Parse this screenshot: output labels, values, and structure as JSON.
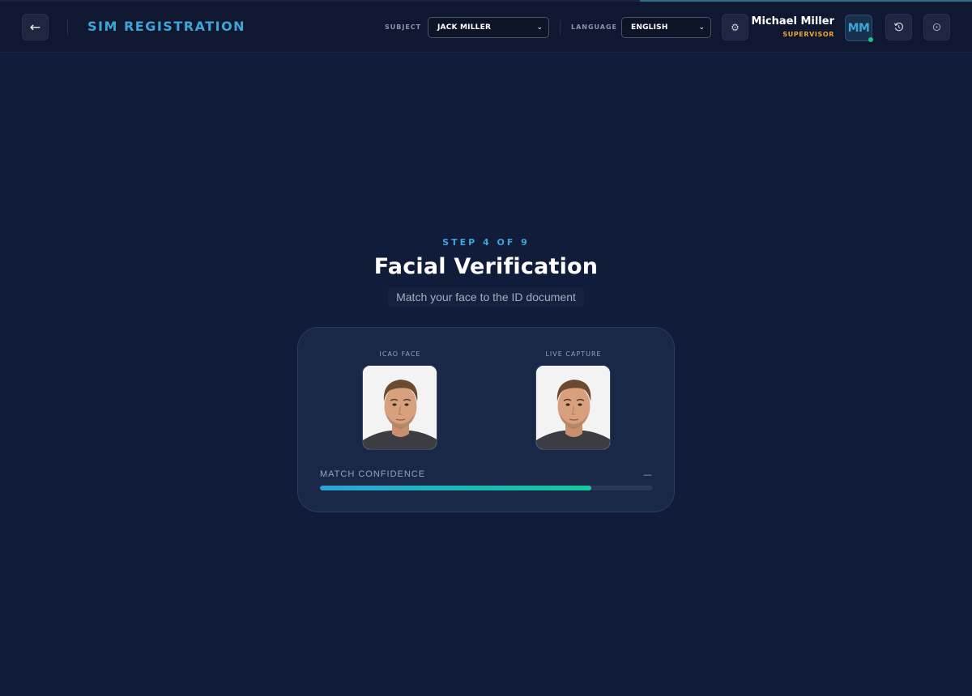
{
  "header": {
    "app_title": "SIM REGISTRATION",
    "subject_label": "SUBJECT",
    "subject_value": "JACK MILLER",
    "language_label": "LANGUAGE",
    "language_value": "ENGLISH",
    "user_name": "Michael Miller",
    "user_role": "SUPERVISOR",
    "user_initials": "MM",
    "icons": {
      "back": "arrow-left-icon",
      "settings": "gear-icon",
      "reset": "reset-icon",
      "power": "power-icon"
    }
  },
  "step": {
    "label": "STEP 4 OF 9",
    "title": "Facial Verification",
    "subtitle": "Match your face to the ID document"
  },
  "card": {
    "icao_label": "ICAO FACE",
    "live_label": "LIVE CAPTURE",
    "match_label": "MATCH CONFIDENCE",
    "match_value": "—",
    "match_progress": 0.816
  },
  "colors": {
    "background": "#111c3b",
    "accent": "#3fa4d8",
    "role": "#f2a52b",
    "online": "#18c08e",
    "bar_start": "#2aa4d8",
    "bar_end": "#14c99b"
  }
}
